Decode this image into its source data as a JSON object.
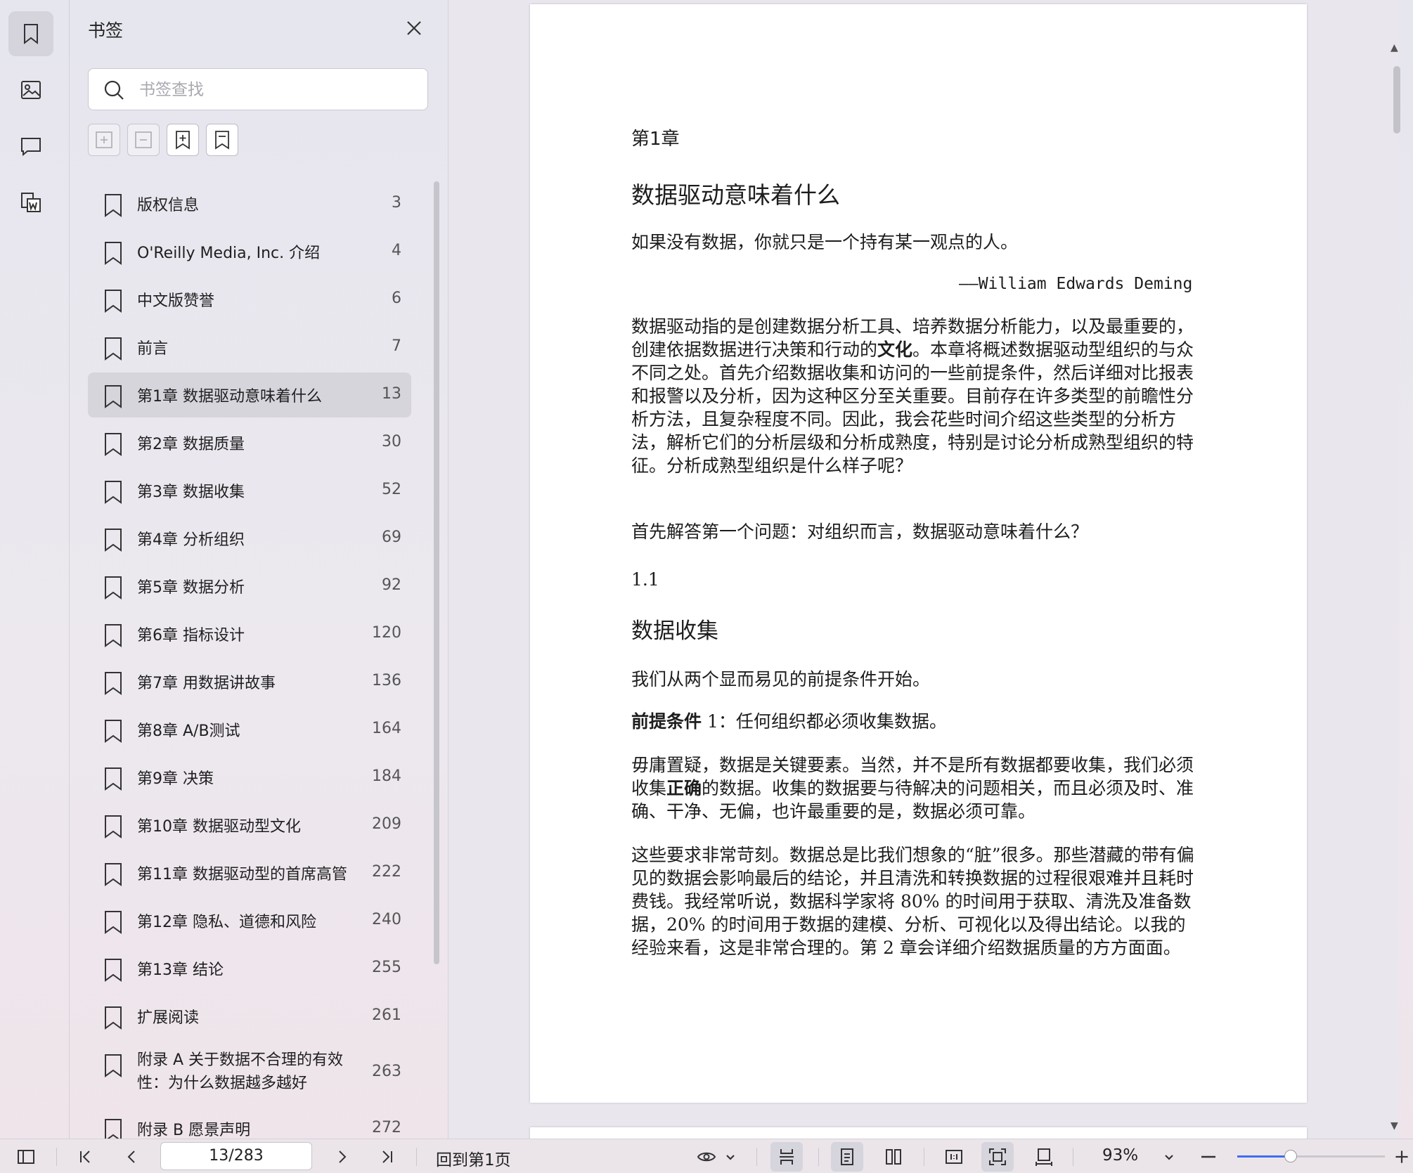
{
  "sidebar_rail": {
    "items": [
      {
        "name": "bookmark-panel",
        "icon": "bookmark-icon",
        "active": true
      },
      {
        "name": "thumbnail-panel",
        "icon": "image-icon",
        "active": false
      },
      {
        "name": "comment-panel",
        "icon": "comment-icon",
        "active": false
      },
      {
        "name": "convert-panel",
        "icon": "word-convert-icon",
        "active": false
      }
    ]
  },
  "bookmarks": {
    "title": "书签",
    "search_placeholder": "书签查找",
    "tools": [
      "expand-all-icon",
      "collapse-all-icon",
      "add-bookmark-icon",
      "bookmark-icon"
    ],
    "items": [
      {
        "label": "版权信息",
        "page": "3"
      },
      {
        "label": "O'Reilly Media, Inc. 介绍",
        "page": "4"
      },
      {
        "label": "中文版赞誉",
        "page": "6"
      },
      {
        "label": "前言",
        "page": "7"
      },
      {
        "label": "第1章 数据驱动意味着什么",
        "page": "13",
        "selected": true
      },
      {
        "label": "第2章 数据质量",
        "page": "30"
      },
      {
        "label": "第3章 数据收集",
        "page": "52"
      },
      {
        "label": "第4章 分析组织",
        "page": "69"
      },
      {
        "label": "第5章 数据分析",
        "page": "92"
      },
      {
        "label": "第6章 指标设计",
        "page": "120"
      },
      {
        "label": "第7章 用数据讲故事",
        "page": "136"
      },
      {
        "label": "第8章 A/B测试",
        "page": "164"
      },
      {
        "label": "第9章 决策",
        "page": "184"
      },
      {
        "label": "第10章 数据驱动型文化",
        "page": "209"
      },
      {
        "label": "第11章 数据驱动型的首席高管",
        "page": "222"
      },
      {
        "label": "第12章 隐私、道德和风险",
        "page": "240"
      },
      {
        "label": "第13章 结论",
        "page": "255"
      },
      {
        "label": "扩展阅读",
        "page": "261"
      },
      {
        "label": "附录 A 关于数据不合理的有效性：为什么数据越多越好",
        "page": "263",
        "two_line": true
      },
      {
        "label": "附录 B 愿景声明",
        "page": "272"
      }
    ]
  },
  "document": {
    "chapter": "第1章",
    "title": "数据驱动意味着什么",
    "quote": "如果没有数据，你就只是一个持有某一观点的人。",
    "quote_attribution": "——William  Edwards  Deming",
    "para1_a": "数据驱动指的是创建数据分析工具、培养数据分析能力，以及最重要的，创建依据数据进行决策和行动的",
    "para1_bold": "文化",
    "para1_b": "。本章将概述数据驱动型组织的与众不同之处。首先介绍数据收集和访问的一些前提条件，然后详细对比报表和报警以及分析，因为这种区分至关重要。目前存在许多类型的前瞻性分析方法，且复杂程度不同。因此，我会花些时间介绍这些类型的分析方法，解析它们的分析层级和分析成熟度，特别是讨论分析成熟型组织的特征。分析成熟型组织是什么样子呢？",
    "para2": "首先解答第一个问题：对组织而言，数据驱动意味着什么？",
    "section_number": "1.1",
    "section_title": "数据收集",
    "para3": "我们从两个显而易见的前提条件开始。",
    "premise_label": "前提条件",
    "premise_text": "  1：任何组织都必须收集数据。",
    "para5_a": "毋庸置疑，数据是关键要素。当然，并不是所有数据都要收集，我们必须收集",
    "para5_bold": "正确",
    "para5_b": "的数据。收集的数据要与待解决的问题相关，而且必须及时、准确、干净、无偏，也许最重要的是，数据必须可靠。",
    "para6": "这些要求非常苛刻。数据总是比我们想象的“脏”很多。那些潜藏的带有偏见的数据会影响最后的结论，并且清洗和转换数据的过程很艰难并且耗时费钱。我经常听说，数据科学家将  80%  的时间用于获取、清洗及准备数据，20%  的时间用于数据的建模、分析、可视化以及得出结论。以我的经验来看，这是非常合理的。第  2  章会详细介绍数据质量的方方面面。"
  },
  "statusbar": {
    "page_indicator": "13/283",
    "back_to_first": "回到第1页",
    "zoom": "93%",
    "zoom_fraction": 0.36,
    "accent_color": "#3c6ff0"
  }
}
